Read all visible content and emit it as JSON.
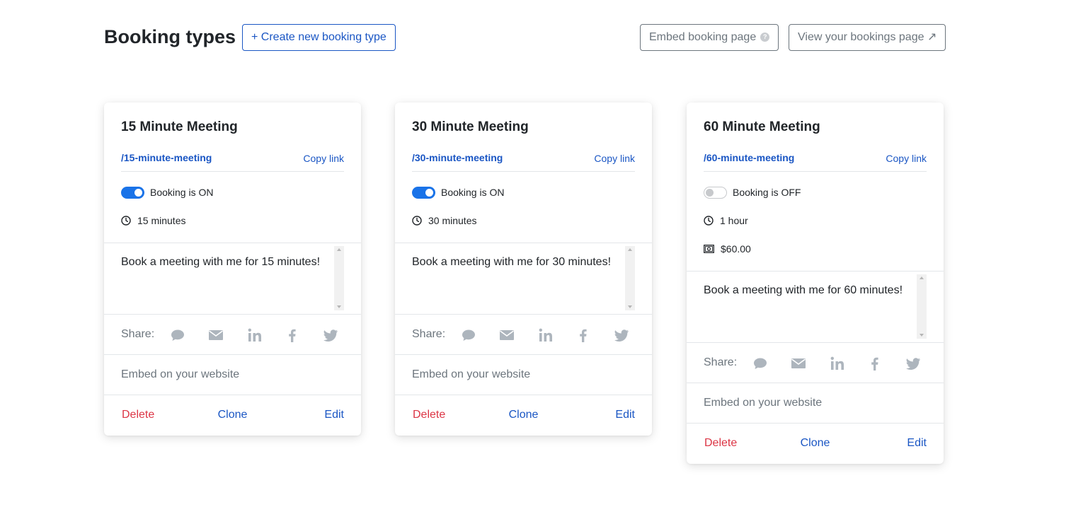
{
  "header": {
    "title": "Booking types",
    "create_button": "+ Create new booking type",
    "embed_button": "Embed booking page",
    "embed_help": "?",
    "view_button": "View your bookings page ↗"
  },
  "colors": {
    "accent": "#1a56c4",
    "toggle_on": "#1a73e8",
    "danger": "#dc3545",
    "muted": "#6c757d",
    "icon_grey": "#adb5bd"
  },
  "labels": {
    "copy_link": "Copy link",
    "share": "Share:",
    "embed": "Embed on your website",
    "delete": "Delete",
    "clone": "Clone",
    "edit": "Edit"
  },
  "share_icons": [
    "chat-icon",
    "email-icon",
    "linkedin-icon",
    "facebook-icon",
    "twitter-icon"
  ],
  "cards": [
    {
      "title": "15 Minute Meeting",
      "slug": "/15-minute-meeting",
      "booking_on": true,
      "booking_status": "Booking is ON",
      "duration": "15 minutes",
      "description": "Book a meeting with me for 15 minutes!"
    },
    {
      "title": "30 Minute Meeting",
      "slug": "/30-minute-meeting",
      "booking_on": true,
      "booking_status": "Booking is ON",
      "duration": "30 minutes",
      "description": "Book a meeting with me for 30 minutes!"
    },
    {
      "title": "60 Minute Meeting",
      "slug": "/60-minute-meeting",
      "booking_on": false,
      "booking_status": "Booking is OFF",
      "duration": "1 hour",
      "price": "$60.00",
      "description": "Book a meeting with me for 60 minutes!"
    }
  ]
}
